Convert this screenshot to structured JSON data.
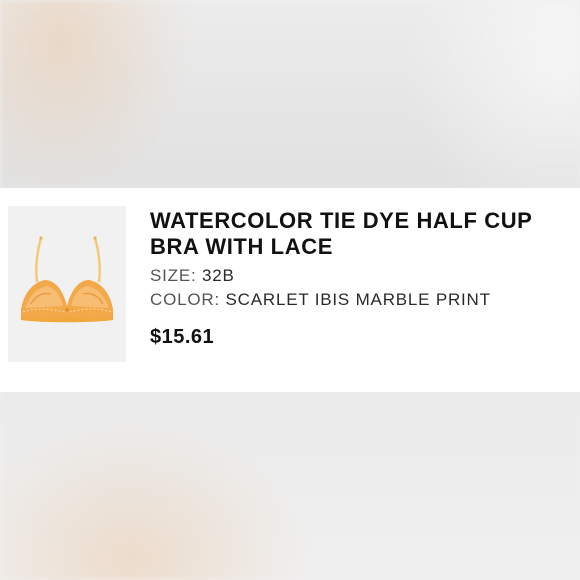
{
  "product": {
    "title": "WATERCOLOR TIE DYE HALF CUP BRA WITH LACE",
    "size_label": "SIZE:",
    "size_value": "32B",
    "color_label": "COLOR:",
    "color_value": "SCARLET IBIS MARBLE PRINT",
    "price": "$15.61",
    "thumbnail_icon": "bra-product-image",
    "accent_color": "#f0a83c"
  }
}
